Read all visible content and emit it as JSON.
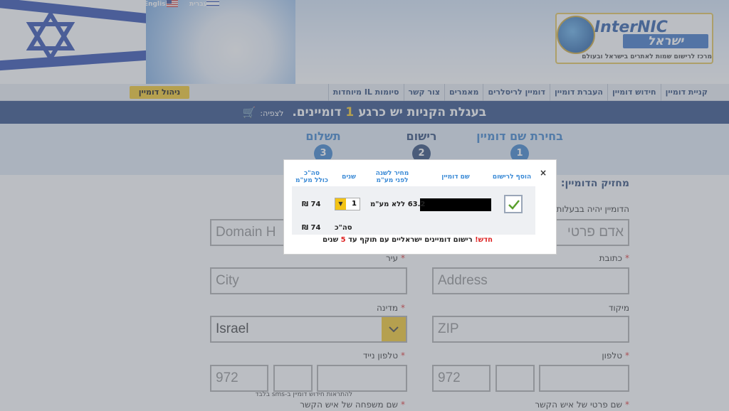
{
  "header": {
    "lang_english": "English",
    "lang_hebrew": "עברית",
    "logo_name": "InterNIC",
    "logo_hebrew": "ישראל",
    "logo_subtitle": "מרכז לרישום שמות לאתרים בישראל ובעולם"
  },
  "nav": {
    "items": [
      "קניית דומיין",
      "חידוש דומיין",
      "העברת דומיין",
      "דומיין לריסלרים",
      "מאמרים",
      "צור קשר",
      "סיומות IL מיוחדות"
    ],
    "manage_label": "ניהול דומיין"
  },
  "cart": {
    "text_before": "בעגלת הקניות יש כרגע",
    "count": "1",
    "text_after": "דומיינים.",
    "view_label": "לצפיה:"
  },
  "steps": [
    {
      "label": "בחירת שם דומיין",
      "number": "1"
    },
    {
      "label": "רישום",
      "number": "2"
    },
    {
      "label": "תשלום",
      "number": "3"
    }
  ],
  "form": {
    "section_title": "מחזיק הדומיין:",
    "owner_label": "הדומיין יהיה בבעלות",
    "owner_value": "אדם פרטי",
    "domain_holder_placeholder": "Domain H",
    "address_label": "כתובת",
    "address_placeholder": "Address",
    "city_label": "עיר",
    "city_placeholder": "City",
    "zip_label": "מיקוד",
    "zip_placeholder": "ZIP",
    "country_label": "מדינה",
    "country_value": "Israel",
    "phone_label": "טלפון",
    "phone_prefix": "972",
    "mobile_label": "טלפון נייד",
    "mobile_prefix": "972",
    "sms_note": "להתראות חידוש דומיין ב-sms בלבד",
    "contact_first_label": "שם פרטי של איש הקשר",
    "contact_last_label": "שם משפחה של איש הקשר",
    "required_mark": "*"
  },
  "modal": {
    "close": "×",
    "col_add": "הוסף לרישום",
    "col_domain": "שם דומיין",
    "col_price_line1": "מחיר לשנה",
    "col_price_line2": "לפני מע\"מ",
    "col_years": "שנים",
    "col_total_line1": "סה\"כ",
    "col_total_line2": "כולל מע\"מ",
    "price": "63.2 ללא מע\"מ",
    "years_value": "1",
    "total": "74 ₪",
    "sum_label": "סה\"כ",
    "sum_total": "74 ₪",
    "promo_new": "חדש!",
    "promo_text": "רישום דומיינים ישראליים עם תוקף עד",
    "promo_years": "5",
    "promo_unit": "שנים"
  }
}
